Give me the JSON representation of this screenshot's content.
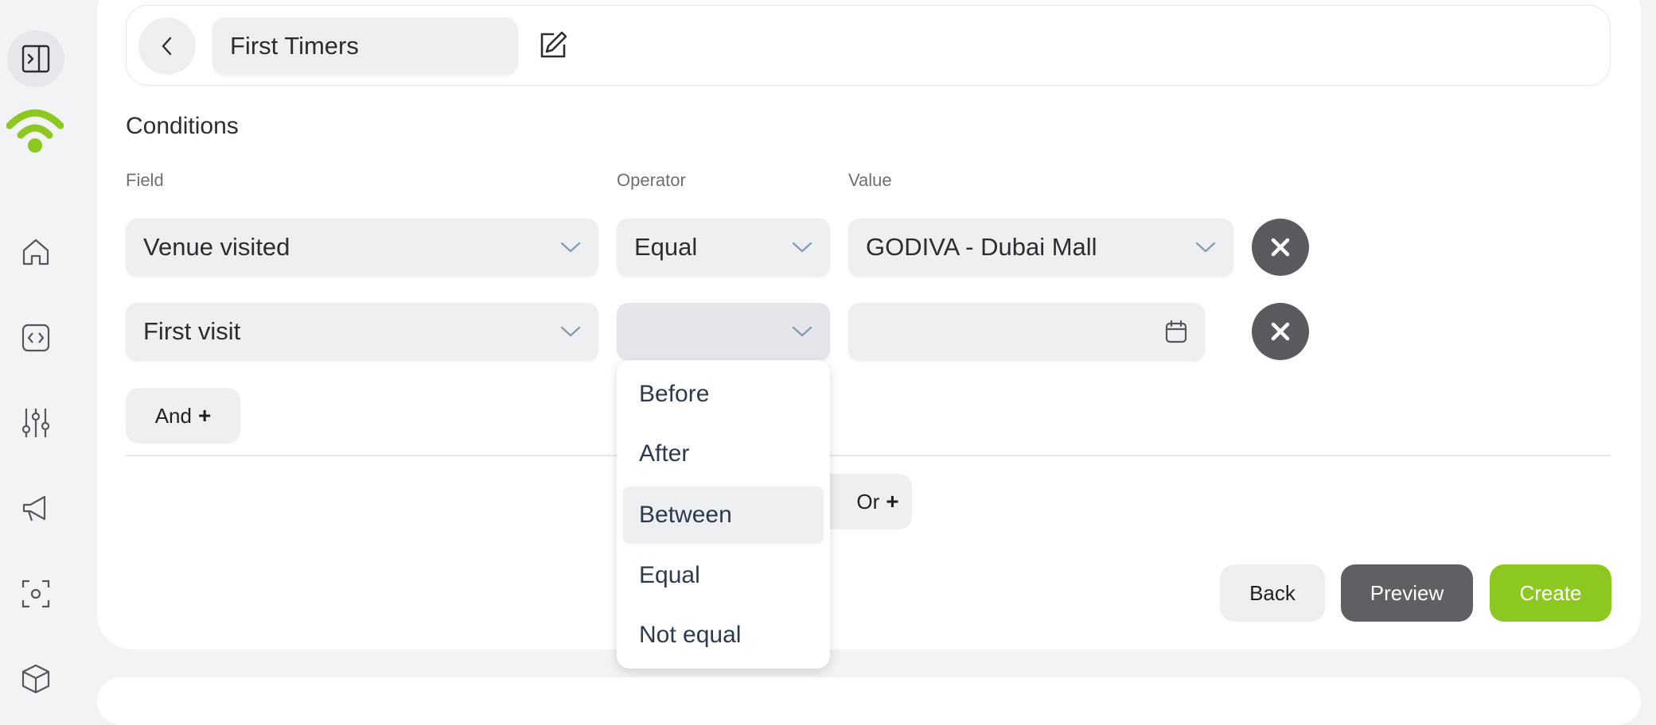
{
  "header": {
    "segment_name": "First Timers"
  },
  "conditions": {
    "title": "Conditions",
    "columns": {
      "field": "Field",
      "operator": "Operator",
      "value": "Value"
    },
    "rows": [
      {
        "field": "Venue visited",
        "operator": "Equal",
        "value": "GODIVA - Dubai Mall"
      },
      {
        "field": "First visit",
        "operator": "",
        "value": ""
      }
    ],
    "and_label": "And",
    "or_label": "Or",
    "plus": "+"
  },
  "operator_dropdown": {
    "options": [
      "Before",
      "After",
      "Between",
      "Equal",
      "Not equal"
    ],
    "highlighted": "Between"
  },
  "actions": {
    "back": "Back",
    "preview": "Preview",
    "create": "Create"
  },
  "colors": {
    "accent": "#8cc820",
    "delete": "#595b5e",
    "preview": "#5f6063"
  }
}
